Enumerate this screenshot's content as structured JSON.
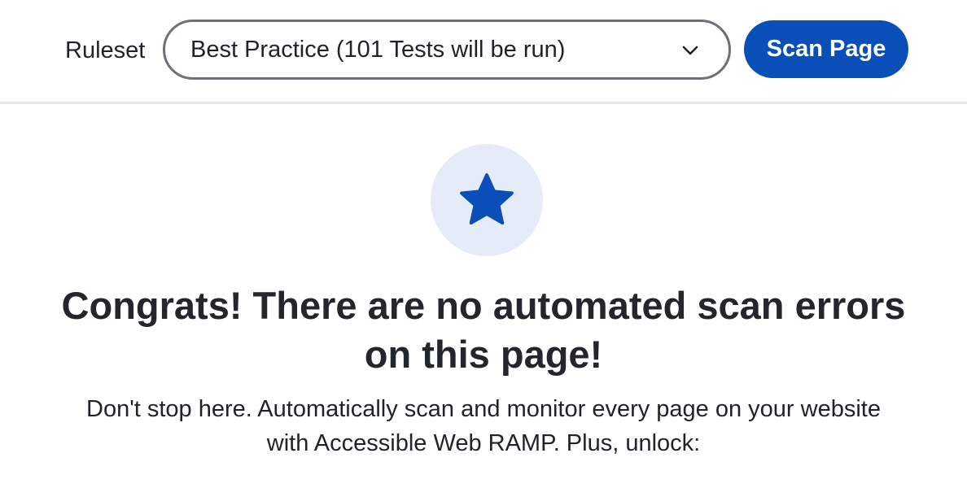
{
  "toolbar": {
    "ruleset_label": "Ruleset",
    "ruleset_selected": "Best Practice (101 Tests will be run)",
    "scan_button_label": "Scan Page"
  },
  "result": {
    "badge_icon": "star-icon",
    "headline": "Congrats! There are no automated scan errors on this page!",
    "message": "Don't stop here. Automatically scan and monitor every page on your website with Accessible Web RAMP. Plus, unlock:"
  },
  "colors": {
    "primary": "#0a4fb8",
    "badge_background": "#e5ecf7",
    "select_border": "#6b7079",
    "divider": "#e4e6ea"
  }
}
